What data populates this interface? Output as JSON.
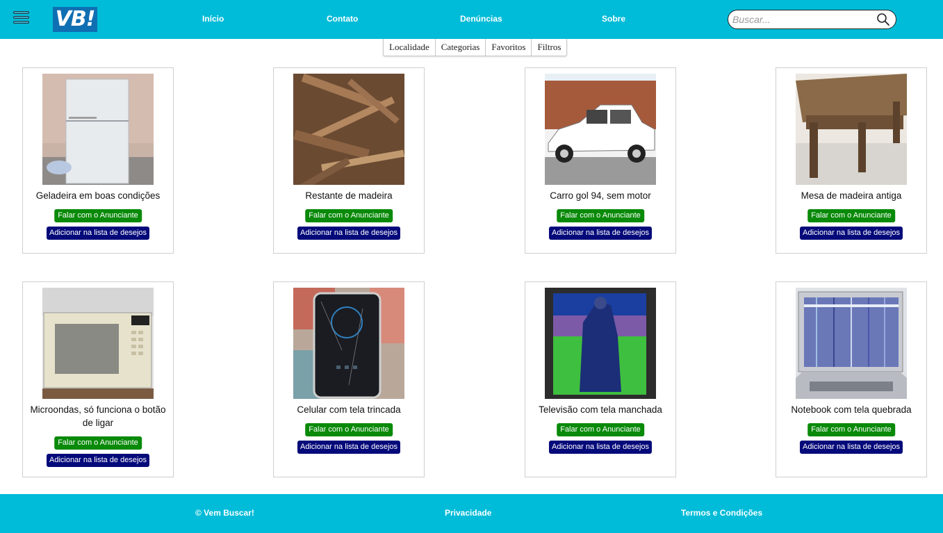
{
  "header": {
    "logo_text": "VB!",
    "nav": [
      "Início",
      "Contato",
      "Denúncias",
      "Sobre"
    ],
    "search_placeholder": "Buscar...",
    "search_value": "",
    "brand_color": "#00bcd8",
    "logo_color": "#0f6fb3"
  },
  "tabs": [
    "Localidade",
    "Categorias",
    "Favoritos",
    "Filtros"
  ],
  "listings": [
    {
      "title": "Geladeira em boas condições",
      "contact_label": "Falar com o Anunciante",
      "wishlist_label": "Adicionar na lista de desejos",
      "image": "refrigerator"
    },
    {
      "title": "Restante de madeira",
      "contact_label": "Falar com o Anunciante",
      "wishlist_label": "Adicionar na lista de desejos",
      "image": "wood-pile"
    },
    {
      "title": "Carro gol 94, sem motor",
      "contact_label": "Falar com o Anunciante",
      "wishlist_label": "Adicionar na lista de desejos",
      "image": "white-car"
    },
    {
      "title": "Mesa de madeira antiga",
      "contact_label": "Falar com o Anunciante",
      "wishlist_label": "Adicionar na lista de desejos",
      "image": "wooden-table"
    },
    {
      "title": "Microondas, só funciona o botão de ligar",
      "contact_label": "Falar com o Anunciante",
      "wishlist_label": "Adicionar na lista de desejos",
      "image": "microwave"
    },
    {
      "title": "Celular com tela trincada",
      "contact_label": "Falar com o Anunciante",
      "wishlist_label": "Adicionar na lista de desejos",
      "image": "cracked-phone"
    },
    {
      "title": "Televisão com tela manchada",
      "contact_label": "Falar com o Anunciante",
      "wishlist_label": "Adicionar na lista de desejos",
      "image": "stained-tv"
    },
    {
      "title": "Notebook com tela quebrada",
      "contact_label": "Falar com o Anunciante",
      "wishlist_label": "Adicionar na lista de desejos",
      "image": "broken-laptop"
    }
  ],
  "footer": {
    "copyright": "© Vem Buscar!",
    "privacy": "Privacidade",
    "terms": "Termos e Condições"
  },
  "colors": {
    "contact_button": "#098a09",
    "wishlist_button": "#050a7a"
  }
}
